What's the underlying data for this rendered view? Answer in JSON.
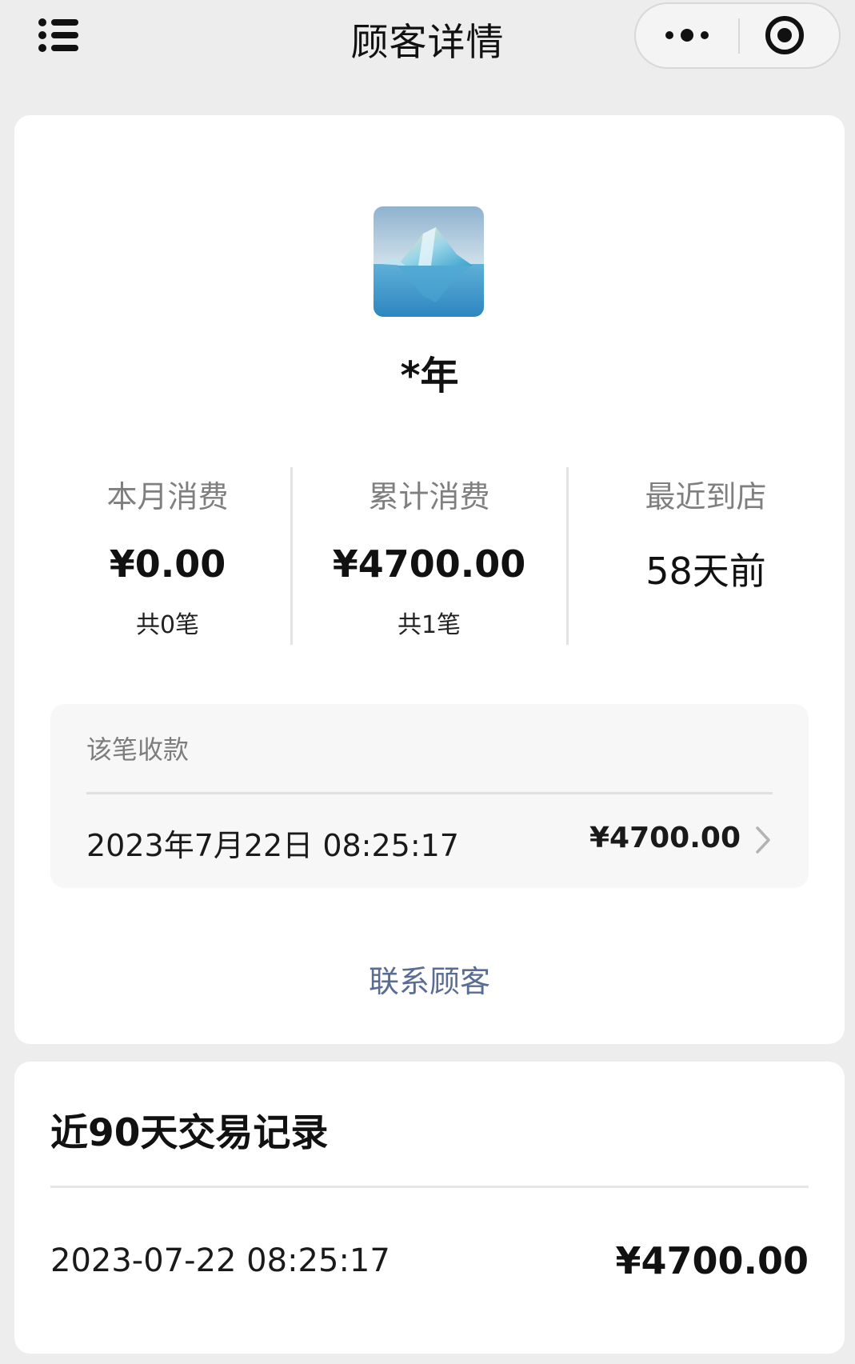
{
  "navbar": {
    "title": "顾客详情",
    "menu_icon": "list-menu-icon",
    "more_icon": "more-dots-icon",
    "close_icon": "target-close-icon"
  },
  "profile": {
    "avatar_description": "iceberg-photo",
    "name": "*年"
  },
  "stats": [
    {
      "label": "本月消费",
      "value": "¥0.00",
      "sub": "共0笔"
    },
    {
      "label": "累计消费",
      "value": "¥4700.00",
      "sub": "共1笔"
    },
    {
      "label": "最近到店",
      "value": "58天前",
      "sub": ""
    }
  ],
  "payment": {
    "title": "该笔收款",
    "datetime": "2023年7月22日 08:25:17",
    "amount": "¥4700.00"
  },
  "contact_label": "联系顾客",
  "history": {
    "title": "近90天交易记录",
    "rows": [
      {
        "datetime": "2023-07-22 08:25:17",
        "amount": "¥4700.00"
      }
    ]
  },
  "colors": {
    "page_bg": "#ededed",
    "card_bg": "#ffffff",
    "link": "#586c94",
    "muted_text": "#7f7f7f"
  }
}
